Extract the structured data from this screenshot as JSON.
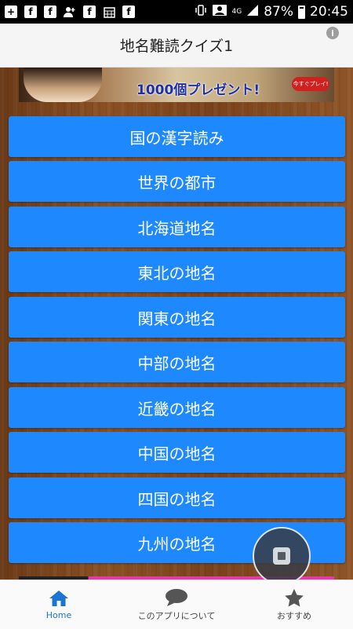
{
  "status_bar": {
    "network": "4G",
    "battery": "87%",
    "time": "20:45"
  },
  "app_bar": {
    "title": "地名難読クイズ1"
  },
  "ad_banner": {
    "text": "1000個プレゼント!",
    "button_label": "今すぐプレイ!"
  },
  "menu": {
    "items": [
      {
        "label": "国の漢字読み"
      },
      {
        "label": "世界の都市"
      },
      {
        "label": "北海道地名"
      },
      {
        "label": "東北の地名"
      },
      {
        "label": "関東の地名"
      },
      {
        "label": "中部の地名"
      },
      {
        "label": "近畿の地名"
      },
      {
        "label": "中国の地名"
      },
      {
        "label": "四国の地名"
      },
      {
        "label": "九州の地名"
      }
    ]
  },
  "bottom_nav": {
    "items": [
      {
        "label": "Home",
        "icon": "home-icon",
        "active": true
      },
      {
        "label": "このアプリについて",
        "icon": "chat-bubble-icon",
        "active": false
      },
      {
        "label": "おすすめ",
        "icon": "star-icon",
        "active": false
      }
    ]
  },
  "colors": {
    "button": "#1e88ff",
    "active_nav": "#1976d2",
    "wood": "#7a421c"
  }
}
